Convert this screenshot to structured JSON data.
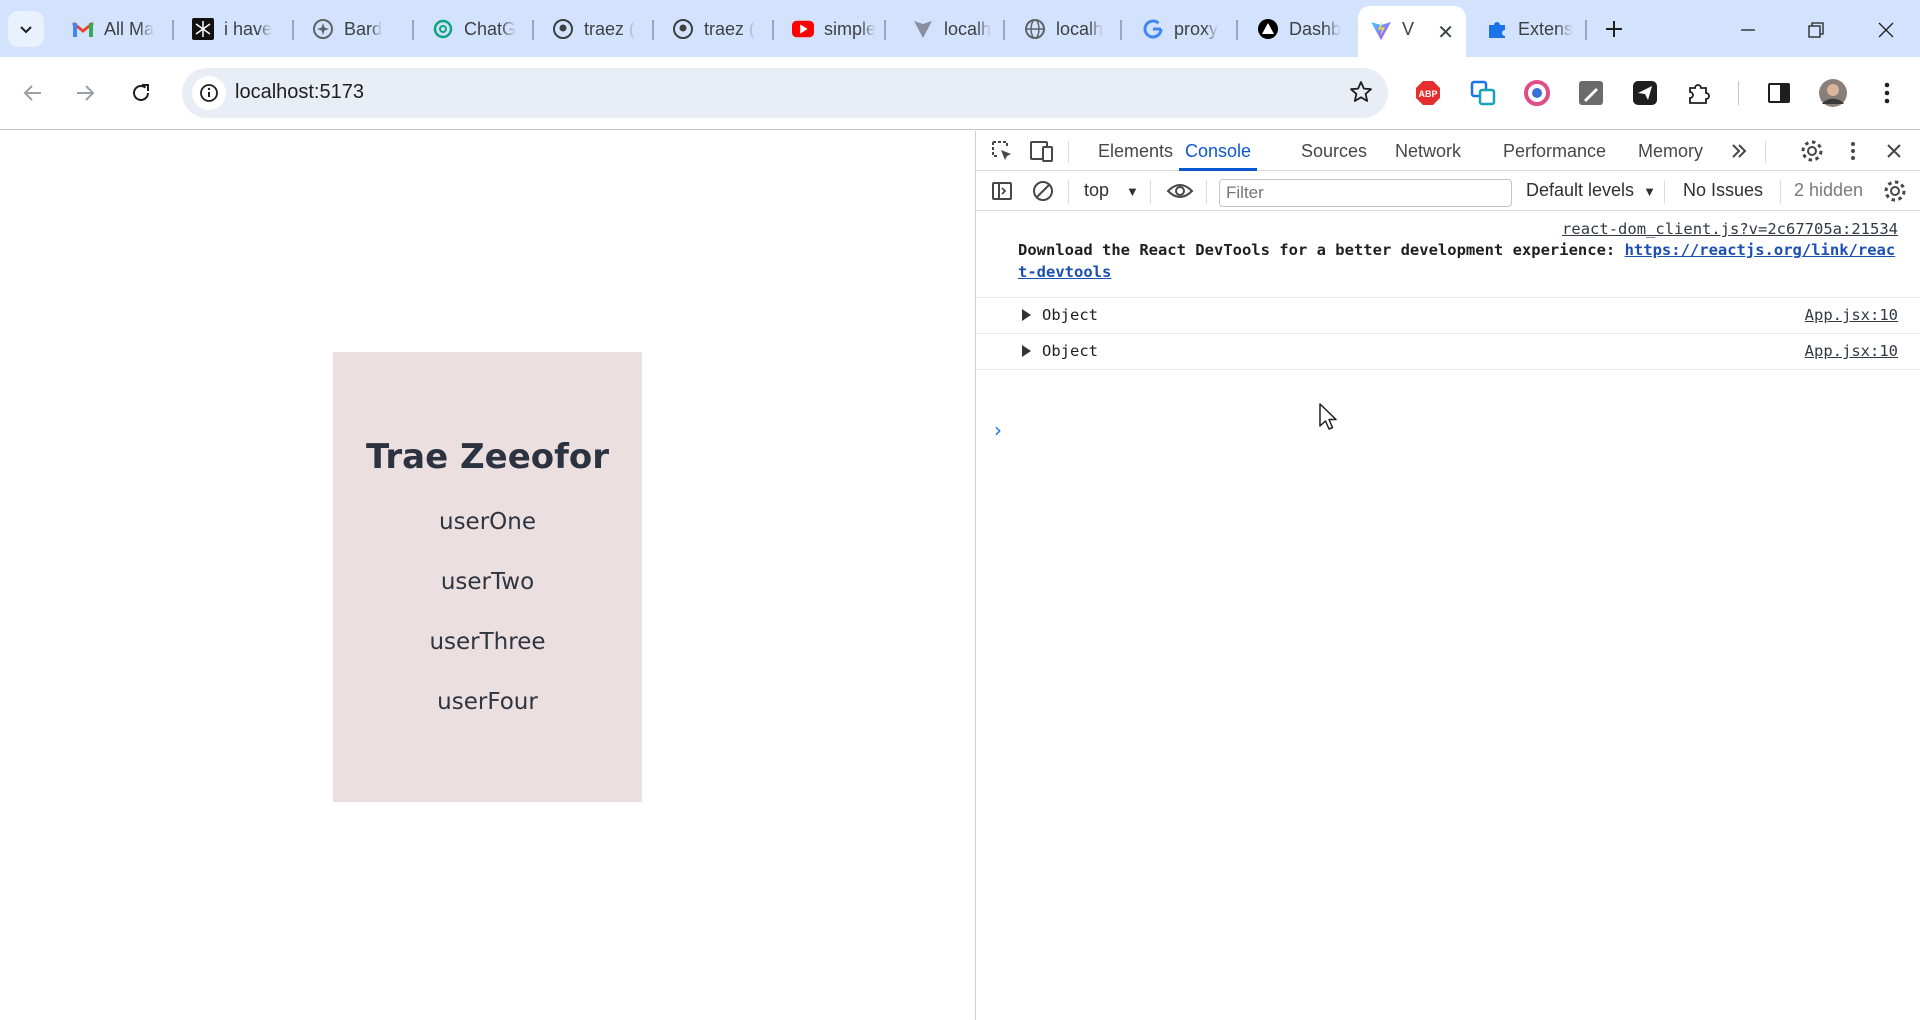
{
  "browser": {
    "tabs": [
      {
        "title": "All Ma",
        "icon": "gmail-icon"
      },
      {
        "title": "i have",
        "icon": "app-icon"
      },
      {
        "title": "Bard",
        "icon": "bard-icon"
      },
      {
        "title": "ChatG",
        "icon": "chatgpt-icon"
      },
      {
        "title": "traez (",
        "icon": "github-icon"
      },
      {
        "title": "traez (",
        "icon": "github-icon"
      },
      {
        "title": "simple",
        "icon": "youtube-icon"
      },
      {
        "title": "localh",
        "icon": "vite-icon"
      },
      {
        "title": "localh",
        "icon": "globe-icon"
      },
      {
        "title": "proxy",
        "icon": "google-icon"
      },
      {
        "title": "Dashb",
        "icon": "dashboard-icon"
      },
      {
        "title": "V",
        "icon": "vite-icon",
        "active": true
      },
      {
        "title": "Extens",
        "icon": "puzzle-icon"
      }
    ],
    "url": "localhost:5173",
    "extensions": [
      "adblock-icon",
      "translate-icon",
      "color-icon",
      "pen-icon",
      "send-icon",
      "extensions-icon",
      "side-panel-icon",
      "profile-avatar"
    ]
  },
  "page": {
    "card": {
      "title": "Trae Zeeofor",
      "users": [
        "userOne",
        "userTwo",
        "userThree",
        "userFour"
      ]
    }
  },
  "devtools": {
    "tabs": [
      "Elements",
      "Console",
      "Sources",
      "Network",
      "Performance",
      "Memory"
    ],
    "active_tab": "Console",
    "context": "top",
    "filter_placeholder": "Filter",
    "levels": "Default levels",
    "issues": "No Issues",
    "hidden": "2 hidden",
    "messages": {
      "first": {
        "source": "react-dom_client.js?v=2c67705a:21534",
        "text": "Download the React DevTools for a better development experience: ",
        "link": "https://reactjs.org/link/react-devtools"
      },
      "objects": [
        {
          "text": "Object",
          "source": "App.jsx:10"
        },
        {
          "text": "Object",
          "source": "App.jsx:10"
        }
      ]
    },
    "prompt": "›"
  },
  "colors": {
    "tabstrip": "#d3e3fd",
    "card_background": "#ecdfe0",
    "devtools_accent": "#0b57d0"
  }
}
